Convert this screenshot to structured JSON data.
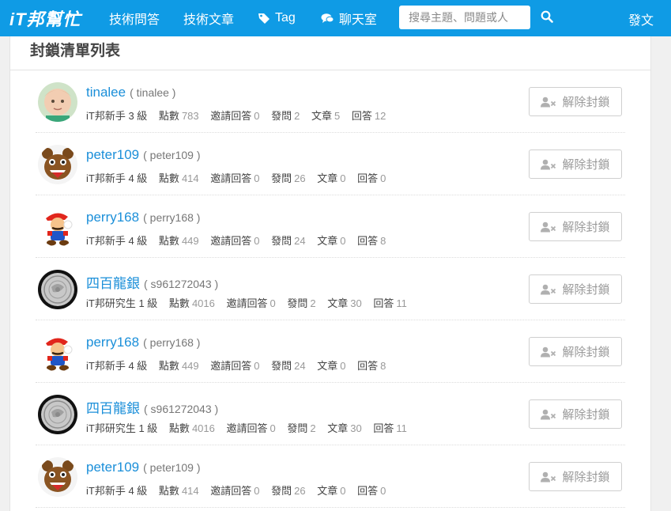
{
  "nav": {
    "logo": "iT邦幫忙",
    "links": [
      "技術問答",
      "技術文章",
      "Tag",
      "聊天室"
    ],
    "search_placeholder": "搜尋主題、問題或人",
    "post": "發文"
  },
  "page": {
    "title": "封鎖清單列表"
  },
  "button_label": "解除封鎖",
  "stat_labels": {
    "points": "點數",
    "invites": "邀請回答",
    "questions": "發問",
    "articles": "文章",
    "answers": "回答"
  },
  "users": [
    {
      "name": "tinalee",
      "account": "( tinalee )",
      "level": "iT邦新手 3 級",
      "points": "783",
      "invites": "0",
      "questions": "2",
      "articles": "5",
      "answers": "12",
      "avatar": "baby"
    },
    {
      "name": "peter109",
      "account": "( peter109 )",
      "level": "iT邦新手 4 級",
      "points": "414",
      "invites": "0",
      "questions": "26",
      "articles": "0",
      "answers": "0",
      "avatar": "bear"
    },
    {
      "name": "perry168",
      "account": "( perry168 )",
      "level": "iT邦新手 4 級",
      "points": "449",
      "invites": "0",
      "questions": "24",
      "articles": "0",
      "answers": "8",
      "avatar": "mario"
    },
    {
      "name": "四百龍銀",
      "account": "( s961272043 )",
      "level": "iT邦研究生 1 級",
      "points": "4016",
      "invites": "0",
      "questions": "2",
      "articles": "30",
      "answers": "11",
      "avatar": "coin"
    },
    {
      "name": "perry168",
      "account": "( perry168 )",
      "level": "iT邦新手 4 級",
      "points": "449",
      "invites": "0",
      "questions": "24",
      "articles": "0",
      "answers": "8",
      "avatar": "mario"
    },
    {
      "name": "四百龍銀",
      "account": "( s961272043 )",
      "level": "iT邦研究生 1 級",
      "points": "4016",
      "invites": "0",
      "questions": "2",
      "articles": "30",
      "answers": "11",
      "avatar": "coin"
    },
    {
      "name": "peter109",
      "account": "( peter109 )",
      "level": "iT邦新手 4 級",
      "points": "414",
      "invites": "0",
      "questions": "26",
      "articles": "0",
      "answers": "0",
      "avatar": "bear"
    }
  ]
}
